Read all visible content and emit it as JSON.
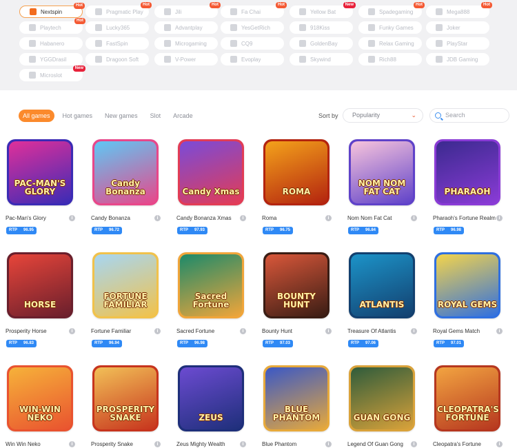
{
  "providers": [
    {
      "label": "Nextspin",
      "icon": "nextspin-logo-icon",
      "active": true,
      "badge": "Hot"
    },
    {
      "label": "Pragmatic Play",
      "icon": "pragmatic-logo-icon",
      "badge": "Hot"
    },
    {
      "label": "Jili",
      "icon": "jili-logo-icon",
      "badge": "Hot"
    },
    {
      "label": "Fa Chai",
      "icon": "fachai-logo-icon",
      "badge": "Hot"
    },
    {
      "label": "Yellow Bat",
      "icon": "yellowbat-logo-icon",
      "badge": "New"
    },
    {
      "label": "Spadegaming",
      "icon": "spadegaming-logo-icon",
      "badge": "Hot"
    },
    {
      "label": "Mega888",
      "icon": "mega888-logo-icon",
      "badge": "Hot"
    },
    {
      "label": "Playtech",
      "icon": "playtech-logo-icon",
      "badge": "Hot"
    },
    {
      "label": "Lucky365",
      "icon": "lucky365-logo-icon"
    },
    {
      "label": "Advantplay",
      "icon": "advantplay-logo-icon"
    },
    {
      "label": "YesGetRich",
      "icon": "yesgetrich-logo-icon"
    },
    {
      "label": "918Kiss",
      "icon": "918kiss-logo-icon"
    },
    {
      "label": "Funky Games",
      "icon": "funkygames-logo-icon"
    },
    {
      "label": "Joker",
      "icon": "joker-logo-icon"
    },
    {
      "label": "Habanero",
      "icon": "habanero-logo-icon"
    },
    {
      "label": "FastSpin",
      "icon": "fastspin-logo-icon"
    },
    {
      "label": "Microgaming",
      "icon": "microgaming-logo-icon"
    },
    {
      "label": "CQ9",
      "icon": "cq9-logo-icon"
    },
    {
      "label": "GoldenBay",
      "icon": "goldenbay-logo-icon"
    },
    {
      "label": "Relax Gaming",
      "icon": "relaxgaming-logo-icon"
    },
    {
      "label": "PlayStar",
      "icon": "playstar-logo-icon"
    },
    {
      "label": "YGGDrasil",
      "icon": "yggdrasil-logo-icon"
    },
    {
      "label": "Dragoon Soft",
      "icon": "dragoonsoft-logo-icon"
    },
    {
      "label": "V-Power",
      "icon": "vpower-logo-icon"
    },
    {
      "label": "Evoplay",
      "icon": "evoplay-logo-icon"
    },
    {
      "label": "Skywind",
      "icon": "skywind-logo-icon"
    },
    {
      "label": "Rich88",
      "icon": "rich88-logo-icon"
    },
    {
      "label": "JDB Gaming",
      "icon": "jdbgaming-logo-icon"
    },
    {
      "label": "Microslot",
      "icon": "microslot-logo-icon",
      "badge": "New"
    }
  ],
  "tabs": [
    {
      "label": "All games",
      "active": true
    },
    {
      "label": "Hot games"
    },
    {
      "label": "New games"
    },
    {
      "label": "Slot"
    },
    {
      "label": "Arcade"
    }
  ],
  "sort": {
    "label": "Sort by",
    "value": "Popularity"
  },
  "search": {
    "placeholder": "Search"
  },
  "rtp_label": "RTP",
  "info_glyph": "i",
  "games": [
    {
      "name": "Pac-Man's Glory",
      "rtp": "96.95",
      "art": "PAC-MAN'S GLORY",
      "c1": "#e0309a",
      "c2": "#3b2bb5"
    },
    {
      "name": "Candy Bonanza",
      "rtp": "96.72",
      "art": "Candy Bonanza",
      "c1": "#5ec8f5",
      "c2": "#e8478a"
    },
    {
      "name": "Candy Bonanza Xmas",
      "rtp": "97.93",
      "art": "Candy Xmas",
      "c1": "#7a4bd8",
      "c2": "#e23c56"
    },
    {
      "name": "Roma",
      "rtp": "96.75",
      "art": "ROMA",
      "c1": "#f4a21b",
      "c2": "#b3240f"
    },
    {
      "name": "Nom Nom Fat Cat",
      "rtp": "96.84",
      "art": "NOM NOM FAT CAT",
      "c1": "#f7c4dc",
      "c2": "#5f42c9"
    },
    {
      "name": "Pharaoh's Fortune Realm",
      "rtp": "96.98",
      "art": "PHARAOH",
      "c1": "#3b2a8f",
      "c2": "#8a3bd6"
    },
    {
      "name": "Prosperity Horse",
      "rtp": "96.83",
      "art": "HORSE",
      "c1": "#e7453a",
      "c2": "#6a1f2c"
    },
    {
      "name": "Fortune Familiar",
      "rtp": "96.94",
      "art": "FORTUNE FAMILIAR",
      "c1": "#a7d6f2",
      "c2": "#f1c24b"
    },
    {
      "name": "Sacred Fortune",
      "rtp": "96.98",
      "art": "Sacred Fortune",
      "c1": "#1c8a6a",
      "c2": "#f0a53a"
    },
    {
      "name": "Bounty Hunt",
      "rtp": "97.03",
      "art": "BOUNTY HUNT",
      "c1": "#d9573a",
      "c2": "#3a1d14"
    },
    {
      "name": "Treasure Of Atlantis",
      "rtp": "97.06",
      "art": "ATLANTIS",
      "c1": "#1c93c8",
      "c2": "#13406f"
    },
    {
      "name": "Royal Gems Match",
      "rtp": "97.01",
      "art": "ROYAL GEMS",
      "c1": "#f4d44b",
      "c2": "#2f6fe0"
    },
    {
      "name": "Win Win Neko",
      "rtp": "",
      "art": "WIN-WIN NEKO",
      "c1": "#f6b23a",
      "c2": "#e9532f"
    },
    {
      "name": "Prosperity Snake",
      "rtp": "",
      "art": "PROSPERITY SNAKE",
      "c1": "#f2c057",
      "c2": "#c7341d"
    },
    {
      "name": "Zeus Mighty Wealth",
      "rtp": "",
      "art": "ZEUS",
      "c1": "#6c4bd1",
      "c2": "#1e2f7a"
    },
    {
      "name": "Blue Phantom",
      "rtp": "",
      "art": "BLUE PHANTOM",
      "c1": "#3a58c6",
      "c2": "#e7a93b"
    },
    {
      "name": "Legend Of Guan Gong",
      "rtp": "",
      "art": "GUAN GONG",
      "c1": "#2f5c3b",
      "c2": "#d9a23a"
    },
    {
      "name": "Cleopatra's Fortune",
      "rtp": "",
      "art": "CLEOPATRA'S FORTUNE",
      "c1": "#f2a441",
      "c2": "#b6371f"
    }
  ]
}
